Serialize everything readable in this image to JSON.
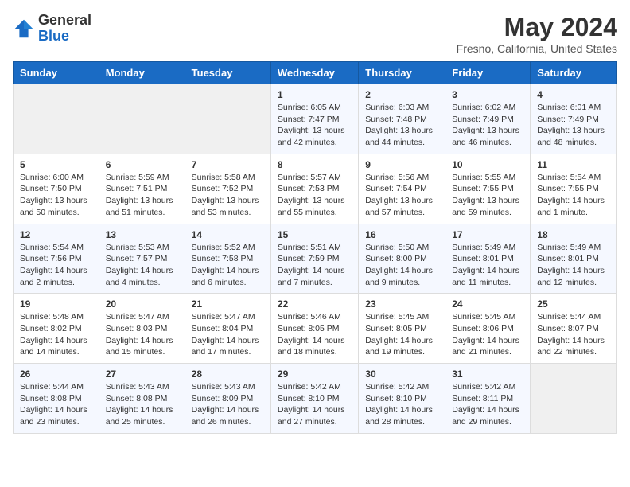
{
  "header": {
    "logo": {
      "general": "General",
      "blue": "Blue"
    },
    "title": "May 2024",
    "location": "Fresno, California, United States"
  },
  "weekdays": [
    "Sunday",
    "Monday",
    "Tuesday",
    "Wednesday",
    "Thursday",
    "Friday",
    "Saturday"
  ],
  "weeks": [
    [
      {
        "day": "",
        "info": ""
      },
      {
        "day": "",
        "info": ""
      },
      {
        "day": "",
        "info": ""
      },
      {
        "day": "1",
        "info": "Sunrise: 6:05 AM\nSunset: 7:47 PM\nDaylight: 13 hours\nand 42 minutes."
      },
      {
        "day": "2",
        "info": "Sunrise: 6:03 AM\nSunset: 7:48 PM\nDaylight: 13 hours\nand 44 minutes."
      },
      {
        "day": "3",
        "info": "Sunrise: 6:02 AM\nSunset: 7:49 PM\nDaylight: 13 hours\nand 46 minutes."
      },
      {
        "day": "4",
        "info": "Sunrise: 6:01 AM\nSunset: 7:49 PM\nDaylight: 13 hours\nand 48 minutes."
      }
    ],
    [
      {
        "day": "5",
        "info": "Sunrise: 6:00 AM\nSunset: 7:50 PM\nDaylight: 13 hours\nand 50 minutes."
      },
      {
        "day": "6",
        "info": "Sunrise: 5:59 AM\nSunset: 7:51 PM\nDaylight: 13 hours\nand 51 minutes."
      },
      {
        "day": "7",
        "info": "Sunrise: 5:58 AM\nSunset: 7:52 PM\nDaylight: 13 hours\nand 53 minutes."
      },
      {
        "day": "8",
        "info": "Sunrise: 5:57 AM\nSunset: 7:53 PM\nDaylight: 13 hours\nand 55 minutes."
      },
      {
        "day": "9",
        "info": "Sunrise: 5:56 AM\nSunset: 7:54 PM\nDaylight: 13 hours\nand 57 minutes."
      },
      {
        "day": "10",
        "info": "Sunrise: 5:55 AM\nSunset: 7:55 PM\nDaylight: 13 hours\nand 59 minutes."
      },
      {
        "day": "11",
        "info": "Sunrise: 5:54 AM\nSunset: 7:55 PM\nDaylight: 14 hours\nand 1 minute."
      }
    ],
    [
      {
        "day": "12",
        "info": "Sunrise: 5:54 AM\nSunset: 7:56 PM\nDaylight: 14 hours\nand 2 minutes."
      },
      {
        "day": "13",
        "info": "Sunrise: 5:53 AM\nSunset: 7:57 PM\nDaylight: 14 hours\nand 4 minutes."
      },
      {
        "day": "14",
        "info": "Sunrise: 5:52 AM\nSunset: 7:58 PM\nDaylight: 14 hours\nand 6 minutes."
      },
      {
        "day": "15",
        "info": "Sunrise: 5:51 AM\nSunset: 7:59 PM\nDaylight: 14 hours\nand 7 minutes."
      },
      {
        "day": "16",
        "info": "Sunrise: 5:50 AM\nSunset: 8:00 PM\nDaylight: 14 hours\nand 9 minutes."
      },
      {
        "day": "17",
        "info": "Sunrise: 5:49 AM\nSunset: 8:01 PM\nDaylight: 14 hours\nand 11 minutes."
      },
      {
        "day": "18",
        "info": "Sunrise: 5:49 AM\nSunset: 8:01 PM\nDaylight: 14 hours\nand 12 minutes."
      }
    ],
    [
      {
        "day": "19",
        "info": "Sunrise: 5:48 AM\nSunset: 8:02 PM\nDaylight: 14 hours\nand 14 minutes."
      },
      {
        "day": "20",
        "info": "Sunrise: 5:47 AM\nSunset: 8:03 PM\nDaylight: 14 hours\nand 15 minutes."
      },
      {
        "day": "21",
        "info": "Sunrise: 5:47 AM\nSunset: 8:04 PM\nDaylight: 14 hours\nand 17 minutes."
      },
      {
        "day": "22",
        "info": "Sunrise: 5:46 AM\nSunset: 8:05 PM\nDaylight: 14 hours\nand 18 minutes."
      },
      {
        "day": "23",
        "info": "Sunrise: 5:45 AM\nSunset: 8:05 PM\nDaylight: 14 hours\nand 19 minutes."
      },
      {
        "day": "24",
        "info": "Sunrise: 5:45 AM\nSunset: 8:06 PM\nDaylight: 14 hours\nand 21 minutes."
      },
      {
        "day": "25",
        "info": "Sunrise: 5:44 AM\nSunset: 8:07 PM\nDaylight: 14 hours\nand 22 minutes."
      }
    ],
    [
      {
        "day": "26",
        "info": "Sunrise: 5:44 AM\nSunset: 8:08 PM\nDaylight: 14 hours\nand 23 minutes."
      },
      {
        "day": "27",
        "info": "Sunrise: 5:43 AM\nSunset: 8:08 PM\nDaylight: 14 hours\nand 25 minutes."
      },
      {
        "day": "28",
        "info": "Sunrise: 5:43 AM\nSunset: 8:09 PM\nDaylight: 14 hours\nand 26 minutes."
      },
      {
        "day": "29",
        "info": "Sunrise: 5:42 AM\nSunset: 8:10 PM\nDaylight: 14 hours\nand 27 minutes."
      },
      {
        "day": "30",
        "info": "Sunrise: 5:42 AM\nSunset: 8:10 PM\nDaylight: 14 hours\nand 28 minutes."
      },
      {
        "day": "31",
        "info": "Sunrise: 5:42 AM\nSunset: 8:11 PM\nDaylight: 14 hours\nand 29 minutes."
      },
      {
        "day": "",
        "info": ""
      }
    ]
  ]
}
